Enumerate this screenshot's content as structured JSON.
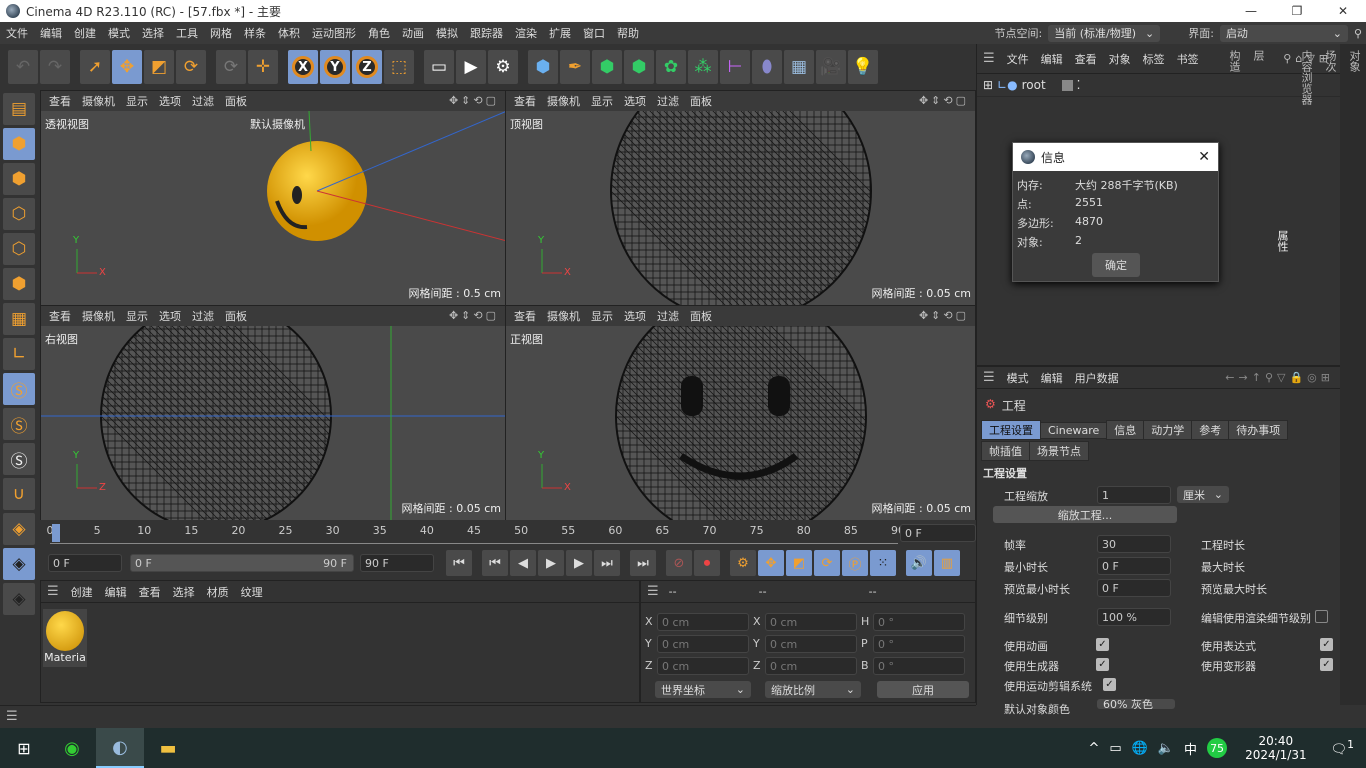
{
  "title": "Cinema 4D R23.110 (RC) - [57.fbx *] - 主要",
  "window_controls": [
    "—",
    "❐",
    "✕"
  ],
  "menu": [
    "文件",
    "编辑",
    "创建",
    "模式",
    "选择",
    "工具",
    "网格",
    "样条",
    "体积",
    "运动图形",
    "角色",
    "动画",
    "模拟",
    "跟踪器",
    "渲染",
    "扩展",
    "窗口",
    "帮助"
  ],
  "node_space": {
    "label": "节点空间:",
    "value": "当前 (标准/物理)"
  },
  "layout": {
    "label": "界面:",
    "value": "启动"
  },
  "viewports": [
    {
      "menu": [
        "查看",
        "摄像机",
        "显示",
        "选项",
        "过滤",
        "面板"
      ],
      "name": "透视视图",
      "camera": "默认摄像机",
      "grid": "网格间距 : 0.5 cm"
    },
    {
      "menu": [
        "查看",
        "摄像机",
        "显示",
        "选项",
        "过滤",
        "面板"
      ],
      "name": "顶视图",
      "grid": "网格间距 : 0.05 cm"
    },
    {
      "menu": [
        "查看",
        "摄像机",
        "显示",
        "选项",
        "过滤",
        "面板"
      ],
      "name": "右视图",
      "grid": "网格间距 : 0.05 cm"
    },
    {
      "menu": [
        "查看",
        "摄像机",
        "显示",
        "选项",
        "过滤",
        "面板"
      ],
      "name": "正视图",
      "grid": "网格间距 : 0.05 cm"
    }
  ],
  "timeline": {
    "ticks": [
      "0",
      "5",
      "10",
      "15",
      "20",
      "25",
      "30",
      "35",
      "40",
      "45",
      "50",
      "55",
      "60",
      "65",
      "70",
      "75",
      "80",
      "85",
      "90"
    ],
    "current": "0 F",
    "start": "0 F",
    "range_start": "0 F",
    "range_end": "90 F",
    "end": "90 F"
  },
  "material_manager": {
    "menu": [
      "创建",
      "编辑",
      "查看",
      "选择",
      "材质",
      "纹理"
    ],
    "materials": [
      {
        "name": "Materia",
        "color": "#f0b400"
      }
    ]
  },
  "coordinates": {
    "headers": [
      "--",
      "--",
      "--"
    ],
    "rows": [
      [
        "X",
        "0 cm",
        "X",
        "0 cm",
        "H",
        "0 °"
      ],
      [
        "Y",
        "0 cm",
        "Y",
        "0 cm",
        "P",
        "0 °"
      ],
      [
        "Z",
        "0 cm",
        "Z",
        "0 cm",
        "B",
        "0 °"
      ]
    ],
    "mode1": "世界坐标",
    "mode2": "缩放比例",
    "apply": "应用"
  },
  "object_manager": {
    "menu": [
      "文件",
      "编辑",
      "查看",
      "对象",
      "标签",
      "书签"
    ],
    "objects": [
      "root"
    ]
  },
  "right_tabs": [
    "对象",
    "场次",
    "内容浏览器",
    "属性",
    "层",
    "构造"
  ],
  "info_dialog": {
    "title": "信息",
    "rows": [
      [
        "内存:",
        "大约 288千字节(KB)"
      ],
      [
        "点:",
        "2551"
      ],
      [
        "多边形:",
        "4870"
      ],
      [
        "对象:",
        "2"
      ]
    ],
    "ok": "确定"
  },
  "attributes": {
    "menu": [
      "模式",
      "编辑",
      "用户数据"
    ],
    "object": "工程",
    "tabs": [
      "工程设置",
      "Cineware",
      "信息",
      "动力学",
      "参考",
      "待办事项",
      "帧插值",
      "场景节点"
    ],
    "section": "工程设置",
    "scale_label": "工程缩放",
    "scale_value": "1",
    "scale_unit": "厘米",
    "scale_button": "缩放工程...",
    "fps_label": "帧率",
    "fps": "30",
    "min_label": "最小时长",
    "min": "0 F",
    "pmin_label": "预览最小时长",
    "pmin": "0 F",
    "len_label": "工程时长",
    "max_label": "最大时长",
    "pmax_label": "预览最大时长",
    "lod_label": "细节级别",
    "lod": "100 %",
    "render_lod_label": "编辑使用渲染细节级别",
    "checks": [
      {
        "label": "使用动画",
        "checked": true
      },
      {
        "label": "使用表达式",
        "checked": true
      },
      {
        "label": "使用生成器",
        "checked": true
      },
      {
        "label": "使用变形器",
        "checked": true
      },
      {
        "label": "使用运动剪辑系统",
        "checked": true
      }
    ],
    "color_label": "默认对象颜色",
    "color_value": "60% 灰色"
  },
  "taskbar": {
    "ime": "中",
    "badge": "75",
    "time": "20:40",
    "date": "2024/1/31",
    "notifications": "1"
  },
  "colors": {
    "accent": "#7a9ad0",
    "icon_orange": "#f0a030",
    "sphere": "#f0b400"
  }
}
